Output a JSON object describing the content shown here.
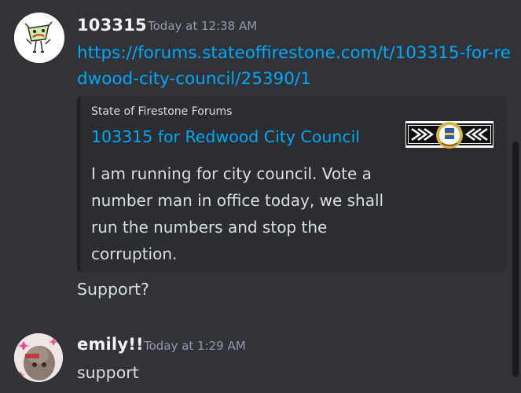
{
  "messages": [
    {
      "username": "103315",
      "timestamp": "Today at 12:38 AM",
      "link": "https://forums.stateoffirestone.com/t/103315-for-redwood-city-council/25390/1",
      "embed": {
        "provider": "State of Firestone Forums",
        "title": "103315 for Redwood City Council",
        "description": "I am running for city council. Vote a number man in office today, we shall run the numbers and stop the corruption."
      },
      "text": "Support?"
    },
    {
      "username": "emily!!",
      "timestamp": "Today at 1:29 AM",
      "text": "support"
    }
  ],
  "colors": {
    "background": "#313338",
    "link": "#00a8fc",
    "embed_bg": "#2b2d31"
  },
  "icons": {
    "avatar1": "cartoon-character-avatar",
    "avatar2": "photo-avatar-with-sparkles",
    "thumbnail": "firestone-seal-logo"
  }
}
